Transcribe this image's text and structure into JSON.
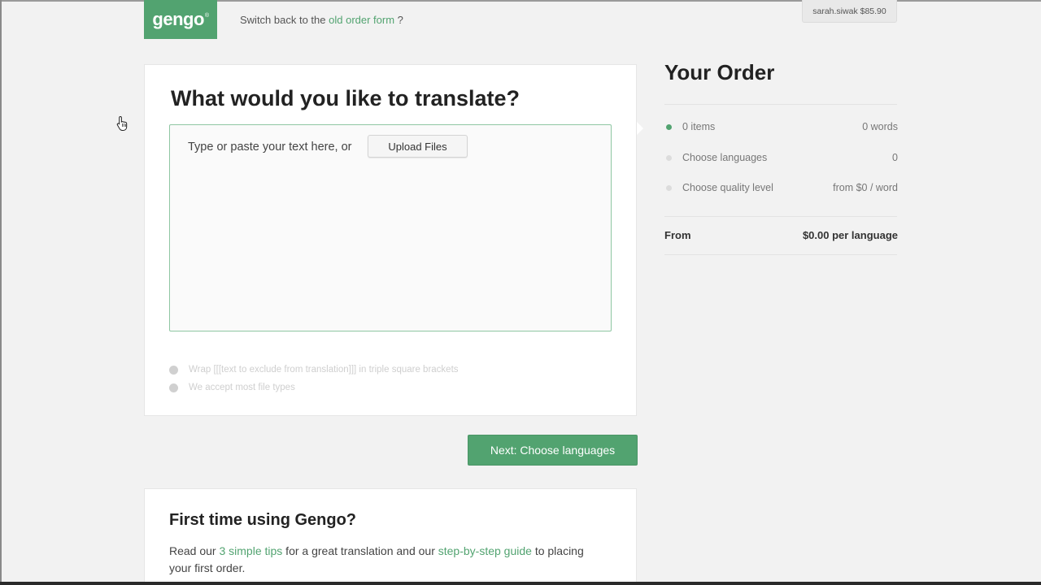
{
  "header": {
    "logo_text": "gengo",
    "logo_mark": "®",
    "switch_prefix": "Switch back to the ",
    "switch_link": "old order form",
    "switch_suffix": " ?",
    "account": "sarah.siwak $85.90"
  },
  "main": {
    "title": "What would you like to translate?",
    "textarea_prompt": "Type or paste your text here, or",
    "upload_label": "Upload Files",
    "tips": [
      "Wrap [[[text to exclude from translation]]] in triple square brackets",
      "We accept most file types"
    ],
    "next_label": "Next: Choose languages"
  },
  "order": {
    "title": "Your Order",
    "rows": [
      {
        "label": "0 items",
        "value": "0 words",
        "active": true
      },
      {
        "label": "Choose languages",
        "value": "0",
        "active": false
      },
      {
        "label": "Choose quality level",
        "value": "from $0 / word",
        "active": false
      }
    ],
    "total_label": "From",
    "total_value": "$0.00 per language"
  },
  "first_time": {
    "title": "First time using Gengo?",
    "text_1": "Read our ",
    "link_1": "3 simple tips",
    "text_2": " for a great translation and our ",
    "link_2": "step-by-step guide",
    "text_3": " to placing your first order."
  },
  "colors": {
    "brand": "#52a370",
    "dot_active": "#52a370",
    "dot_inactive": "#dcdcdc"
  },
  "icons": {
    "cursor": "hand-pointer-icon",
    "tip": "info-circle-icon",
    "status_dot": "status-dot-icon"
  }
}
